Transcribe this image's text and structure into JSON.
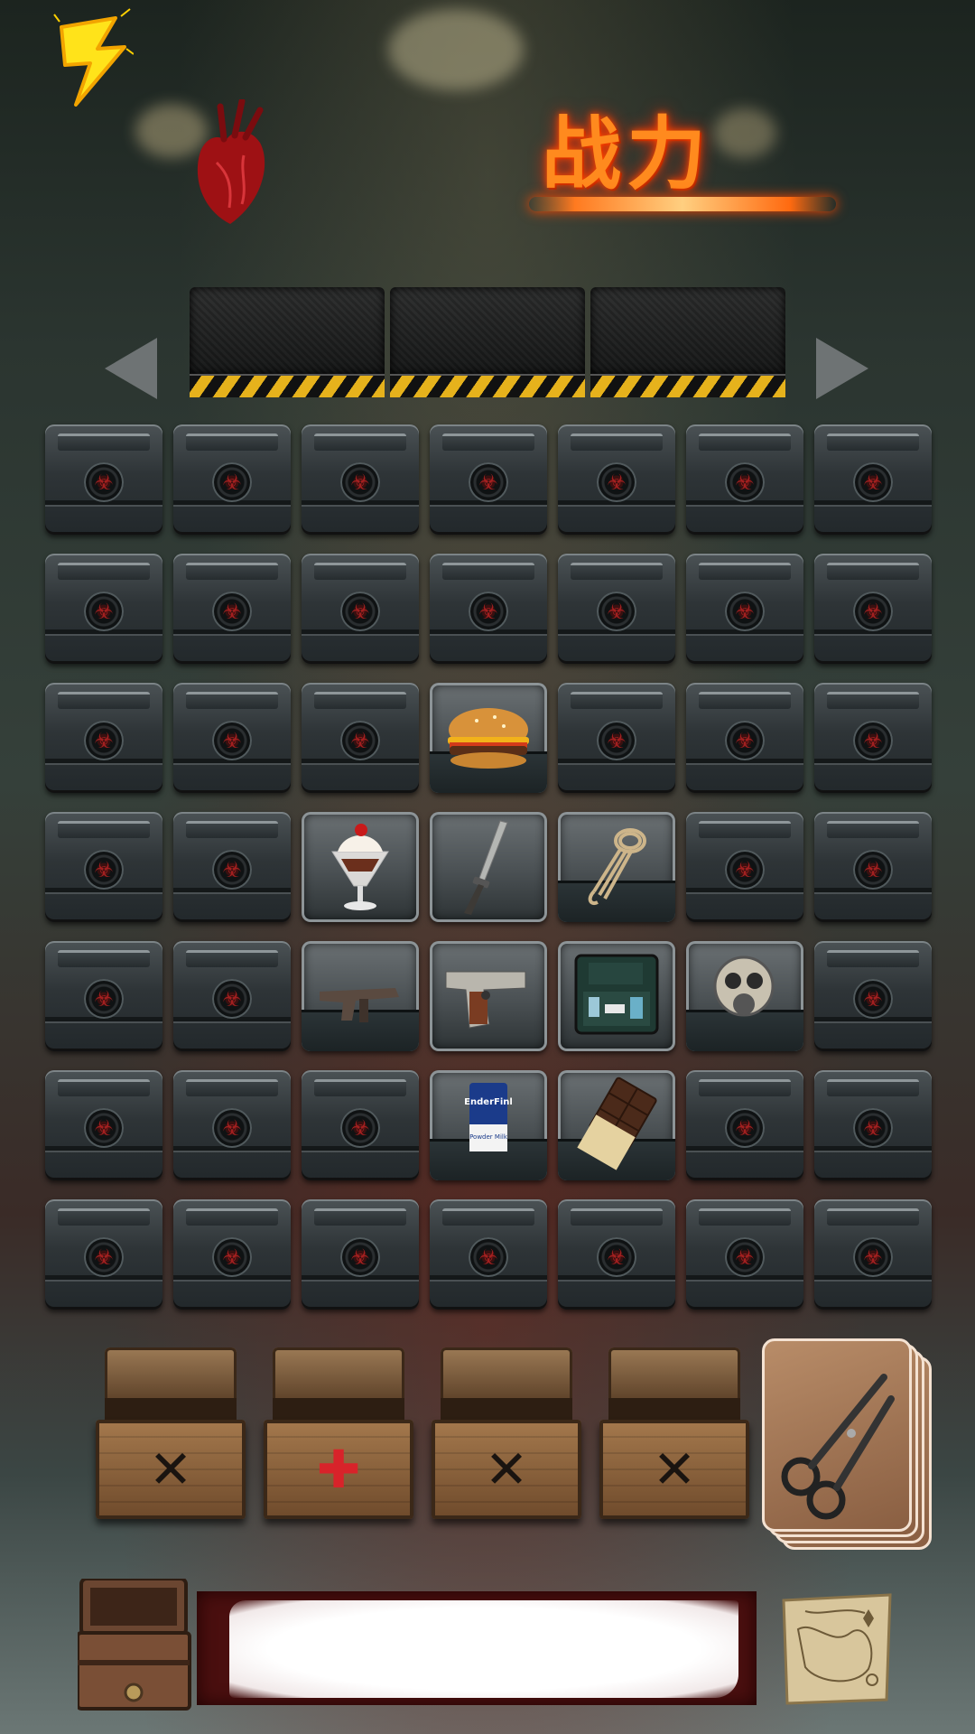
{
  "hud": {
    "power_title": "战力",
    "energy_icon": "lightning-bolt-icon",
    "health_icon": "anatomical-heart-icon"
  },
  "inventory_tabs": [
    {
      "label": ""
    },
    {
      "label": ""
    },
    {
      "label": ""
    }
  ],
  "grid": {
    "columns": 7,
    "rows": 7,
    "empty_slot_emblem": "☣",
    "items": [
      {
        "row": 2,
        "col": 3,
        "name": "burger",
        "icon": "burger-icon",
        "style": "pocket"
      },
      {
        "row": 3,
        "col": 2,
        "name": "ice-cream-sundae",
        "icon": "sundae-icon",
        "style": "plain"
      },
      {
        "row": 3,
        "col": 3,
        "name": "combat-knife",
        "icon": "knife-icon",
        "style": "plain"
      },
      {
        "row": 3,
        "col": 4,
        "name": "rope",
        "icon": "rope-icon",
        "style": "pocket"
      },
      {
        "row": 4,
        "col": 2,
        "name": "submachine-gun",
        "icon": "smg-icon",
        "style": "pocket"
      },
      {
        "row": 4,
        "col": 3,
        "name": "pistol",
        "icon": "pistol-icon",
        "style": "plain"
      },
      {
        "row": 4,
        "col": 4,
        "name": "medical-case",
        "icon": "medkit-case-icon",
        "style": "plain"
      },
      {
        "row": 4,
        "col": 5,
        "name": "gas-mask",
        "icon": "gas-mask-icon",
        "style": "pocket"
      },
      {
        "row": 5,
        "col": 3,
        "name": "powder-milk",
        "icon": "milk-powder-icon",
        "style": "pocket",
        "label_lines": [
          "EnderFinl",
          "Powder Milk"
        ]
      },
      {
        "row": 5,
        "col": 4,
        "name": "chocolate-bar",
        "icon": "chocolate-icon",
        "style": "pocket"
      }
    ]
  },
  "chests": [
    {
      "name": "food-chest",
      "symbol": "✕",
      "icon": "crossed-fork-knife-icon",
      "color": "#1a1410"
    },
    {
      "name": "medical-chest",
      "symbol": "✚",
      "icon": "red-cross-icon",
      "color": "#d8232a"
    },
    {
      "name": "ammo-chest",
      "symbol": "✕",
      "icon": "crossed-bullets-icon",
      "color": "#1a1410"
    },
    {
      "name": "tools-chest",
      "symbol": "✕",
      "icon": "crossed-tools-icon",
      "color": "#1a1410"
    }
  ],
  "crafting_card": {
    "icon": "scissors-icon"
  },
  "bottom": {
    "storage_icon": "open-chest-icon",
    "message_text": "",
    "map_icon": "treasure-map-icon"
  }
}
